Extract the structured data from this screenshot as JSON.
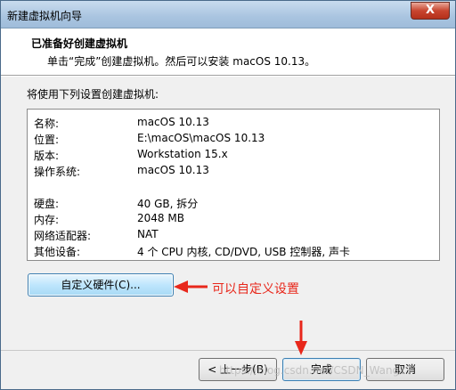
{
  "window": {
    "title": "新建虚拟机向导",
    "close_label": "X"
  },
  "header": {
    "title": "已准备好创建虚拟机",
    "subtitle": "单击“完成”创建虚拟机。然后可以安装 macOS 10.13。"
  },
  "summary": {
    "label": "将使用下列设置创建虚拟机:",
    "rows": [
      {
        "key": "名称:",
        "value": "macOS 10.13"
      },
      {
        "key": "位置:",
        "value": "E:\\macOS\\macOS 10.13"
      },
      {
        "key": "版本:",
        "value": "Workstation 15.x"
      },
      {
        "key": "操作系统:",
        "value": "macOS 10.13"
      },
      {
        "key": "硬盘:",
        "value": "40 GB, 拆分"
      },
      {
        "key": "内存:",
        "value": "2048 MB"
      },
      {
        "key": "网络适配器:",
        "value": "NAT"
      },
      {
        "key": "其他设备:",
        "value": "4 个 CPU 内核, CD/DVD, USB 控制器, 声卡"
      }
    ]
  },
  "buttons": {
    "customize": "自定义硬件(C)...",
    "back": "< 上一步(B)",
    "finish": "完成",
    "cancel": "取消"
  },
  "annotation": {
    "text": "可以自定义设置",
    "color": "#e8271b"
  },
  "watermark": "https://blog.csdn.net/CSDN_Wang17"
}
